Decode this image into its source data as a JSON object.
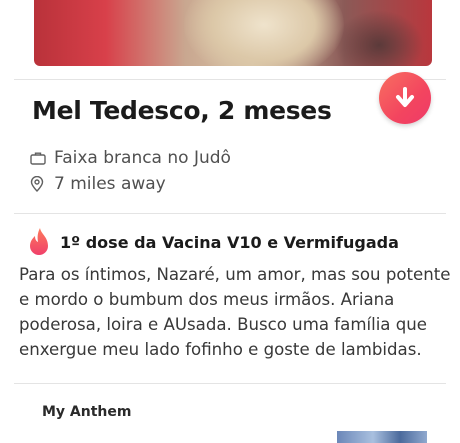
{
  "profile": {
    "name_age": "Mel Tedesco, 2 meses",
    "job": "Faixa branca no Judô",
    "distance": "7 miles away"
  },
  "highlight": {
    "text": "1º dose da Vacina V10 e Vermifugada",
    "icon": "flame-icon"
  },
  "bio_lines": [
    "Para os íntimos, Nazaré, um amor, mas sou potente",
    "e mordo o bumbum dos meus irmãos. Ariana",
    "poderosa, loira e AUsada. Busco uma família que",
    "enxergue meu lado fofinho e goste de lambidas."
  ],
  "anthem": {
    "label": "My Anthem"
  },
  "colors": {
    "accent": "#f3455f",
    "accent_start": "#f86f60",
    "text": "#1e1e1e",
    "muted": "#505050"
  },
  "icons": {
    "job": "briefcase-icon",
    "location": "location-pin-icon",
    "collapse": "arrow-down-icon"
  }
}
